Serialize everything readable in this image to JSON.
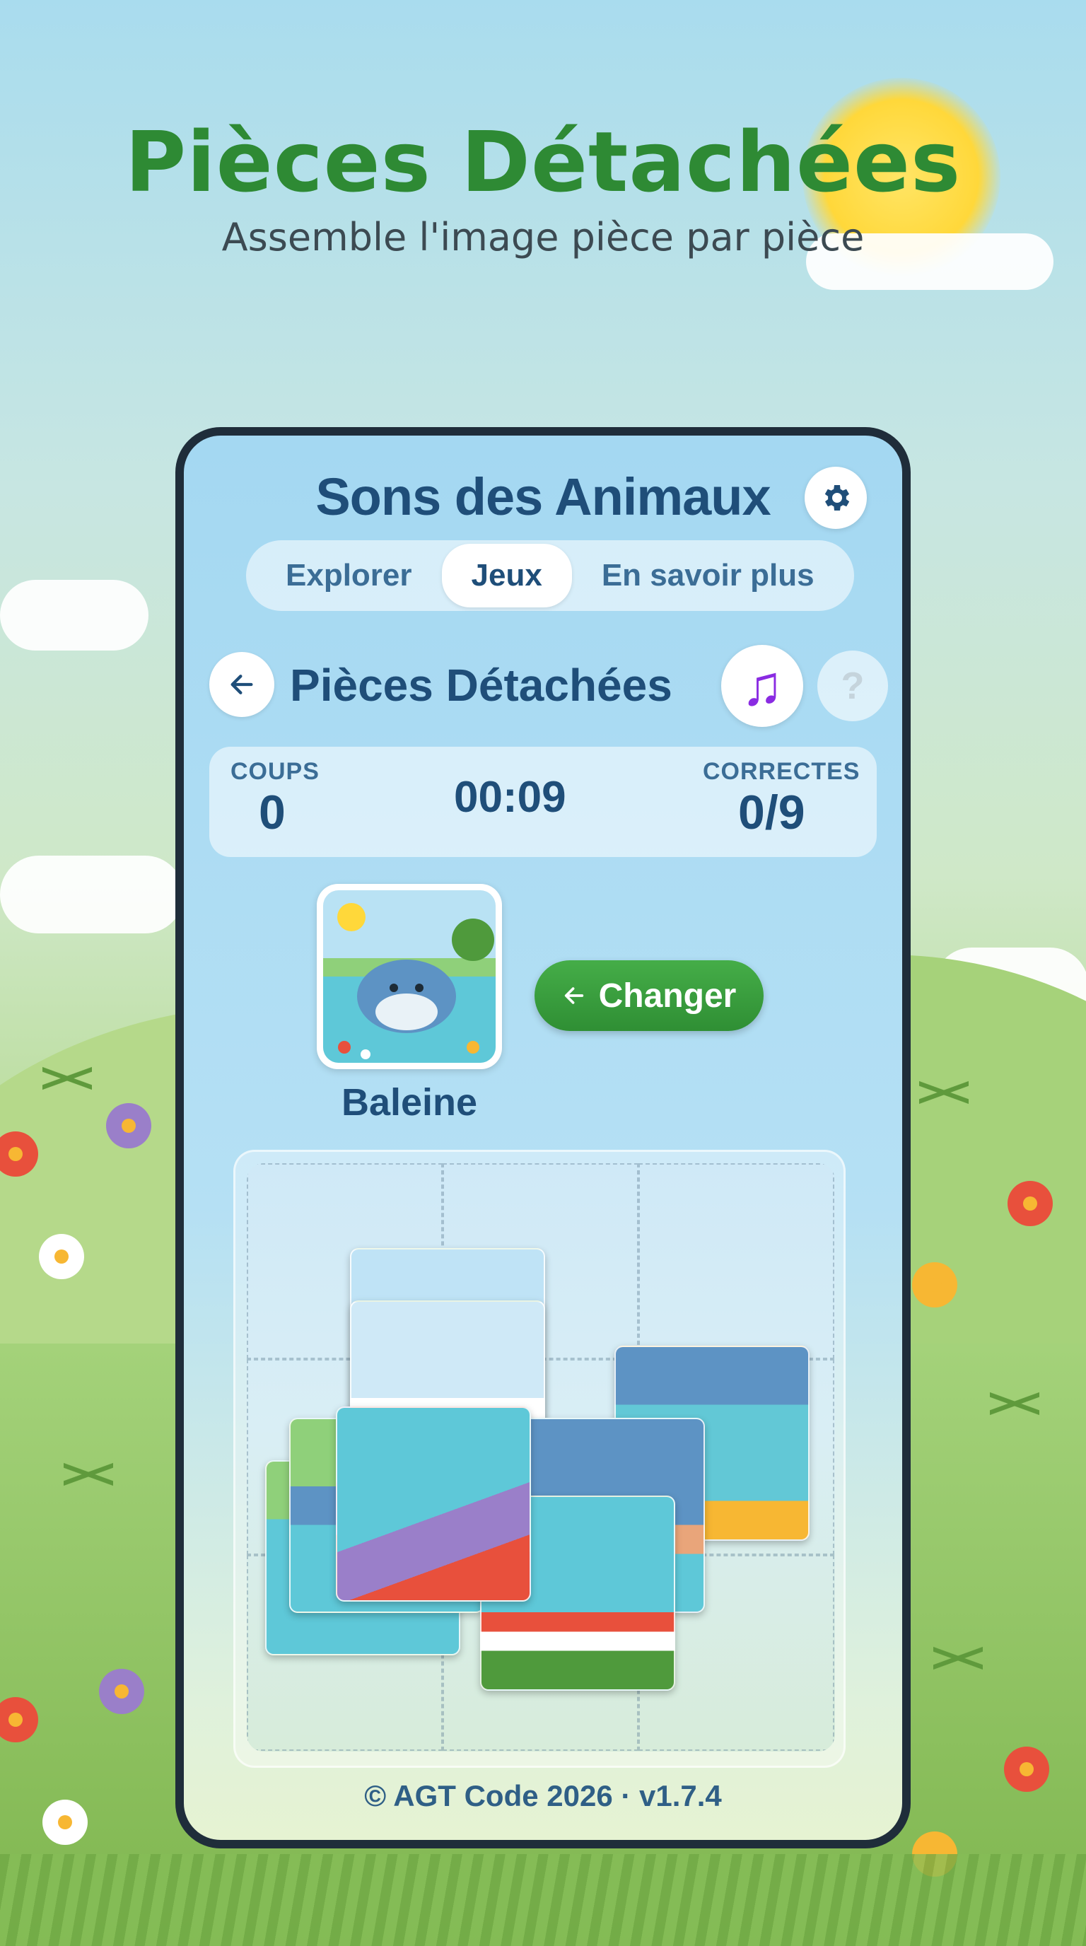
{
  "header": {
    "title": "Pièces Détachées",
    "subtitle": "Assemble l'image pièce par pièce"
  },
  "app": {
    "title": "Sons des Animaux",
    "settings_icon": "gear-icon",
    "tabs": [
      {
        "label": "Explorer",
        "active": false
      },
      {
        "label": "Jeux",
        "active": true
      },
      {
        "label": "En savoir plus",
        "active": false
      }
    ]
  },
  "game": {
    "back_icon": "arrow-left-icon",
    "title": "Pièces Détachées",
    "music_icon": "♫",
    "help_icon": "?",
    "stats": {
      "moves_label": "COUPS",
      "moves_value": "0",
      "timer": "00:09",
      "correct_label": "CORRECTES",
      "correct_value": "0/9"
    },
    "preview": {
      "animal_name": "Baleine",
      "image": "whale-illustration"
    },
    "change_button": {
      "icon": "arrow-left-icon",
      "label": "Changer"
    },
    "board": {
      "grid": "3x3",
      "pieces_total": 9,
      "pieces_placed": 0
    }
  },
  "footer": {
    "text": "© AGT Code 2026 · v1.7.4"
  },
  "colors": {
    "brand_green": "#2e8a34",
    "app_navy": "#1f4e79",
    "button_green": "#3a9e3e",
    "music_purple": "#8a2be2"
  }
}
